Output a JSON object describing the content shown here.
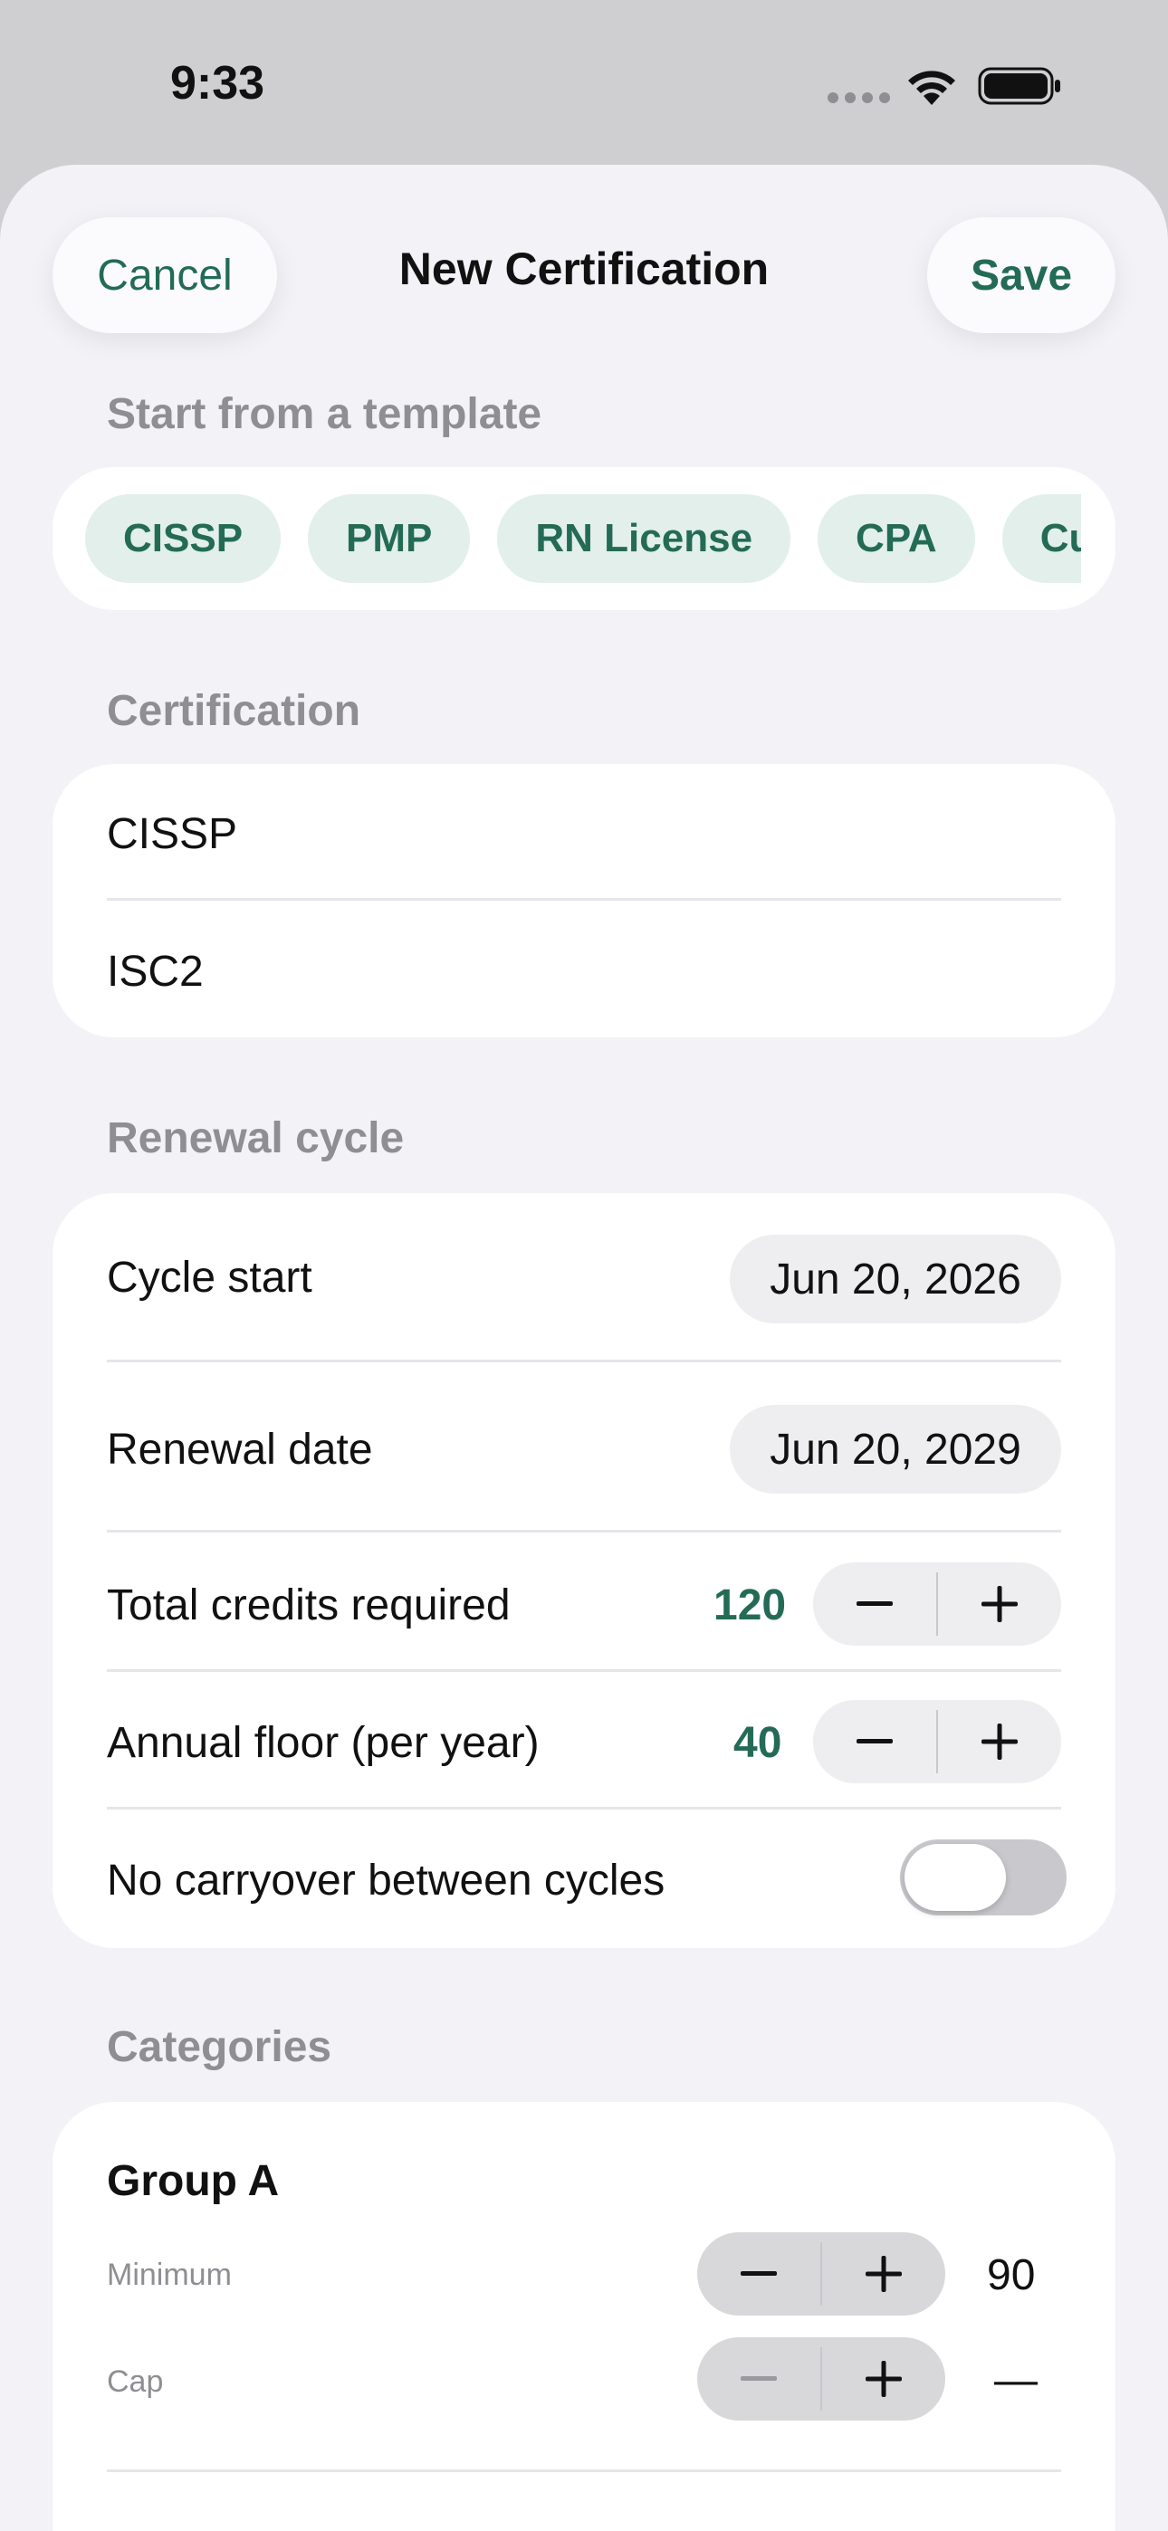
{
  "status_bar": {
    "time": "9:33",
    "icons": [
      "cellular-dots-icon",
      "wifi-icon",
      "battery-icon"
    ]
  },
  "nav": {
    "cancel_label": "Cancel",
    "title": "New Certification",
    "save_label": "Save"
  },
  "templates": {
    "section_label": "Start from a template",
    "chips": [
      "CISSP",
      "PMP",
      "RN License",
      "CPA",
      "Custom"
    ]
  },
  "certification": {
    "section_label": "Certification",
    "name_value": "CISSP",
    "issuer_value": "ISC2"
  },
  "renewal": {
    "section_label": "Renewal cycle",
    "cycle_start_label": "Cycle start",
    "cycle_start_value": "Jun 20, 2026",
    "renewal_date_label": "Renewal date",
    "renewal_date_value": "Jun 20, 2029",
    "total_credits_label": "Total credits required",
    "total_credits_value": "120",
    "annual_floor_label": "Annual floor (per year)",
    "annual_floor_value": "40",
    "no_carryover_label": "No carryover between cycles",
    "no_carryover_on": false
  },
  "categories": {
    "section_label": "Categories",
    "groups": [
      {
        "title": "Group A",
        "minimum_label": "Minimum",
        "minimum_value": "90",
        "cap_label": "Cap",
        "cap_value": "—"
      }
    ]
  },
  "colors": {
    "accent": "#246b55",
    "chip_bg": "#e2efea",
    "sheet_bg": "#f2f2f7",
    "backdrop": "#cfcfd1"
  }
}
